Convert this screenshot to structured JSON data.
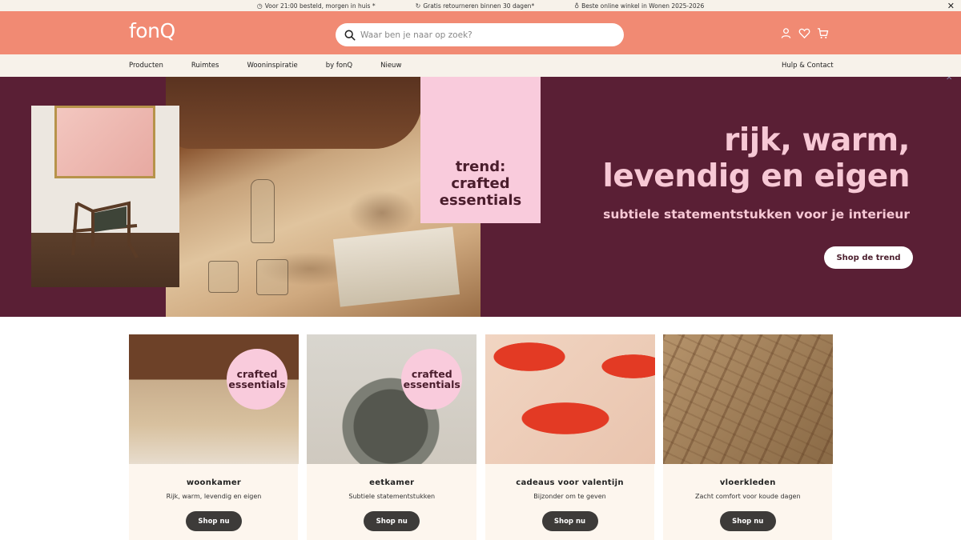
{
  "usp": {
    "items": [
      {
        "icon": "clock-icon",
        "text": "Voor 21:00 besteld, morgen in huis *"
      },
      {
        "icon": "return-icon",
        "text": "Gratis retourneren binnen 30 dagen*"
      },
      {
        "icon": "award-icon",
        "text": "Beste online winkel in Wonen 2025-2026"
      }
    ],
    "close": "✕"
  },
  "header": {
    "logo": "fonQ",
    "search_placeholder": "Waar ben je naar op zoek?",
    "icons": [
      "user-icon",
      "heart-icon",
      "cart-icon"
    ],
    "bg_color": "#f18a73"
  },
  "nav": {
    "items": [
      "Producten",
      "Ruimtes",
      "Wooninspiratie",
      "by fonQ",
      "Nieuw"
    ],
    "help": "Hulp & Contact"
  },
  "hero": {
    "pink_lines": [
      "trend:",
      "crafted",
      "essentials"
    ],
    "title_lines": [
      "rijk, warm,",
      "levendig en eigen"
    ],
    "subtitle": "subtiele statementstukken voor je interieur",
    "button": "Shop de trend",
    "bg_color": "#5a1f35",
    "accent_color": "#f7c8d5"
  },
  "cards": [
    {
      "title": "woonkamer",
      "subtitle": "Rijk, warm, levendig en eigen",
      "button": "Shop nu",
      "badge": [
        "crafted",
        "essentials"
      ]
    },
    {
      "title": "eetkamer",
      "subtitle": "Subtiele statementstukken",
      "button": "Shop nu",
      "badge": [
        "crafted",
        "essentials"
      ]
    },
    {
      "title": "cadeaus voor valentijn",
      "subtitle": "Bijzonder om te geven",
      "button": "Shop nu"
    },
    {
      "title": "vloerkleden",
      "subtitle": "Zacht comfort voor koude dagen",
      "button": "Shop nu"
    }
  ]
}
